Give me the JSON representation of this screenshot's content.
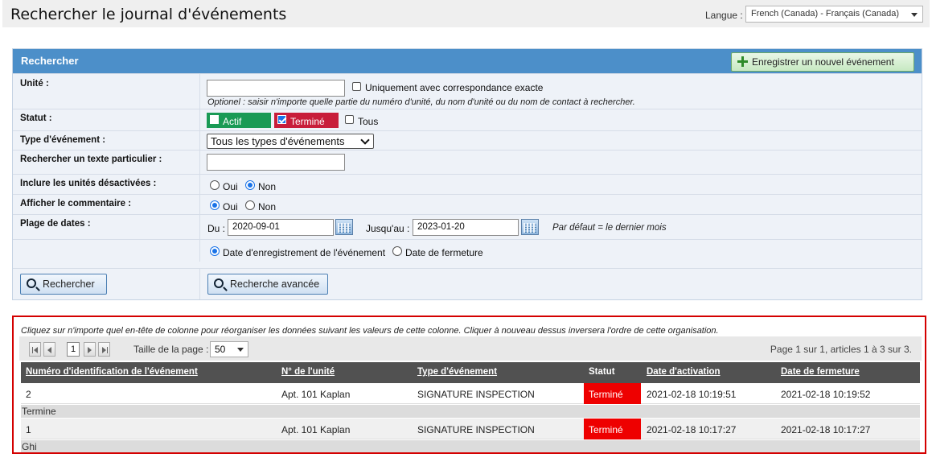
{
  "header": {
    "title": "Rechercher le journal d'événements",
    "language_label": "Langue :",
    "language_value": "French (Canada) - Français (Canada)"
  },
  "search": {
    "panel_title": "Rechercher",
    "new_event_button": "Enregistrer un nouvel événement",
    "unit": {
      "label": "Unité :",
      "value": "",
      "exact_match_label": "Uniquement avec correspondance exacte",
      "hint": "Optionel : saisir n'importe quelle partie du numéro d'unité, du nom d'unité ou du nom de contact à rechercher."
    },
    "status": {
      "label": "Statut :",
      "active": "Actif",
      "done": "Terminé",
      "all": "Tous",
      "active_checked": false,
      "done_checked": true,
      "all_checked": false,
      "active_color": "#1a9a55",
      "done_color": "#c81d3a"
    },
    "event_type": {
      "label": "Type d'événement :",
      "selected": "Tous les types d'événements"
    },
    "text_search": {
      "label": "Rechercher un texte particulier :",
      "value": ""
    },
    "include_disabled": {
      "label": "Inclure les unités désactivées :",
      "yes": "Oui",
      "no": "Non",
      "selected": "Non"
    },
    "show_comment": {
      "label": "Afficher le commentaire :",
      "yes": "Oui",
      "no": "Non",
      "selected": "Oui"
    },
    "date_range": {
      "label": "Plage de dates :",
      "from_label": "Du :",
      "from_value": "2020-09-01",
      "to_label": "Jusqu'au :",
      "to_value": "2023-01-20",
      "default_hint": "Par défaut = le dernier mois",
      "basis_record": "Date d'enregistrement de l'événement",
      "basis_close": "Date de fermeture",
      "basis_selected": "record"
    },
    "search_button": "Rechercher",
    "advanced_button": "Recherche avancée"
  },
  "results": {
    "hint": "Cliquez sur n'importe quel en-tête de colonne pour réorganiser les données suivant les valeurs de cette colonne. Cliquer à nouveau dessus inversera l'ordre de cette organisation.",
    "current_page": "1",
    "page_size_label": "Taille de la page :",
    "page_size": "50",
    "page_info": "Page 1 sur 1, articles 1 à 3 sur 3.",
    "columns": [
      "Numéro d'identification de l'événement",
      "N° de l'unité",
      "Type d'événement",
      "Statut",
      "Date d'activation",
      "Date de fermeture"
    ],
    "status_color": "#ee0000",
    "rows": [
      {
        "id": "2",
        "unit": "Apt. 101 Kaplan",
        "type": "SIGNATURE INSPECTION",
        "status": "Terminé",
        "activated": "2021-02-18 10:19:51",
        "closed": "2021-02-18 10:19:52",
        "comment": "Termine"
      },
      {
        "id": "1",
        "unit": "Apt. 101 Kaplan",
        "type": "SIGNATURE INSPECTION",
        "status": "Terminé",
        "activated": "2021-02-18 10:17:27",
        "closed": "2021-02-18 10:17:27",
        "comment": "Ghi"
      }
    ]
  }
}
